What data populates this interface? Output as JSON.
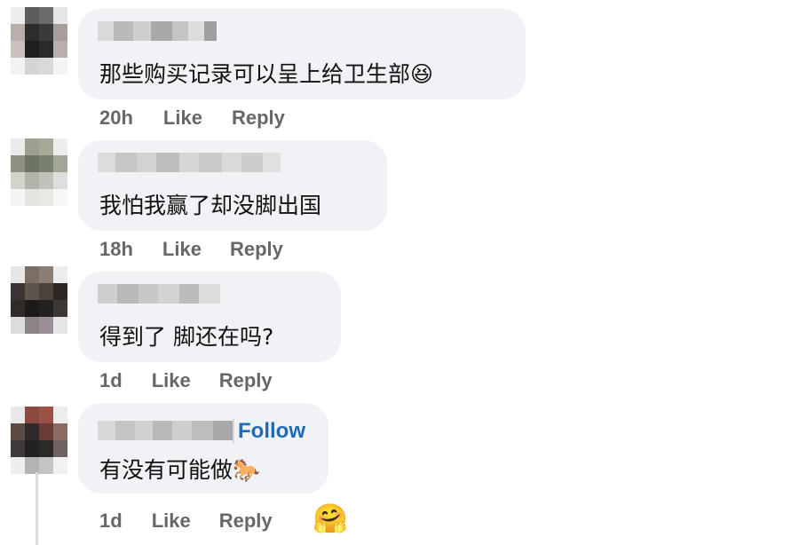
{
  "comments": [
    {
      "text": "那些购买记录可以呈上给卫生部",
      "emoji": "😆",
      "time": "20h",
      "like_label": "Like",
      "reply_label": "Reply"
    },
    {
      "text": "我怕我赢了却没脚出国",
      "time": "18h",
      "like_label": "Like",
      "reply_label": "Reply"
    },
    {
      "text": "得到了 脚还在吗?",
      "time": "1d",
      "like_label": "Like",
      "reply_label": "Reply"
    },
    {
      "text": "有没有可能做",
      "emoji": "🐎",
      "follow_label": "Follow",
      "time": "1d",
      "like_label": "Like",
      "reply_label": "Reply",
      "reaction_emoji": "🤗"
    }
  ],
  "colors": {
    "bubble_bg": "#f0f2f5",
    "text": "#111111",
    "action_text": "#65676b",
    "follow_link": "#1f6bb5"
  }
}
